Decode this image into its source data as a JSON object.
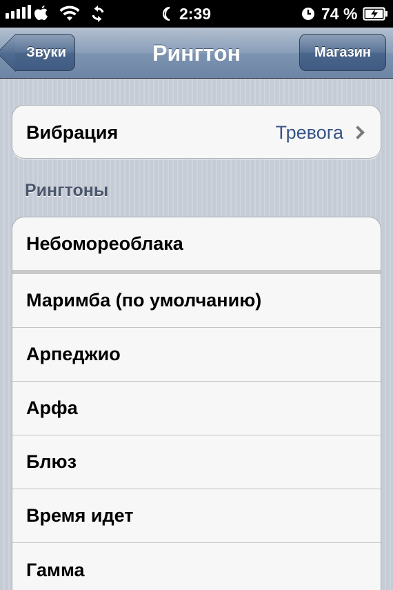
{
  "status_bar": {
    "time": "2:39",
    "battery_percent": "74 %",
    "icons": [
      "signal-icon",
      "apple-icon",
      "wifi-icon",
      "sync-icon",
      "moon-icon",
      "alarm-icon",
      "battery-icon"
    ]
  },
  "nav": {
    "back_label": "Звуки",
    "title": "Рингтон",
    "store_label": "Магазин"
  },
  "vibration": {
    "label": "Вибрация",
    "value": "Тревога"
  },
  "ringtones": {
    "header": "Рингтоны",
    "items": [
      "Небомореоблака",
      "Маримба (по умолчанию)",
      "Арпеджио",
      "Арфа",
      "Блюз",
      "Время идет",
      "Гамма"
    ]
  },
  "colors": {
    "nav_bar": "#7c93b0",
    "value_text": "#385487",
    "section_header": "#4c566c"
  }
}
